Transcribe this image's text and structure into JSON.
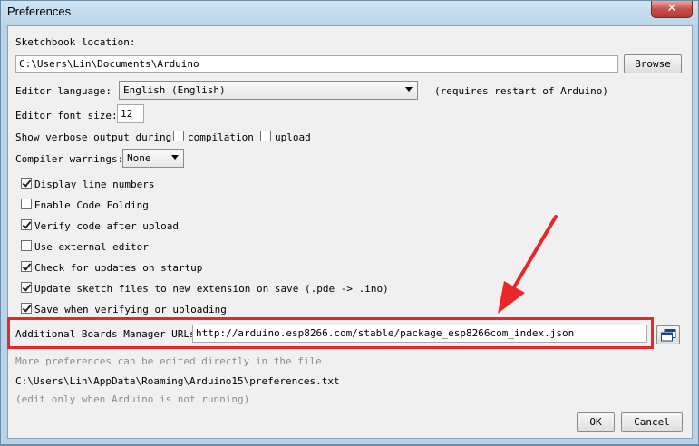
{
  "window": {
    "title": "Preferences",
    "close_glyph": "✕"
  },
  "sketchbook": {
    "label": "Sketchbook location:",
    "path": "C:\\Users\\Lin\\Documents\\Arduino",
    "browse_label": "Browse"
  },
  "language": {
    "label": "Editor language:",
    "value": "English (English)",
    "note": "(requires restart of Arduino)"
  },
  "font_size": {
    "label": "Editor font size:",
    "value": "12"
  },
  "verbose": {
    "label": "Show verbose output during:",
    "compilation_label": "compilation",
    "compilation_checked": false,
    "upload_label": "upload",
    "upload_checked": false
  },
  "warnings": {
    "label": "Compiler warnings:",
    "value": "None"
  },
  "options": [
    {
      "label": "Display line numbers",
      "checked": true
    },
    {
      "label": "Enable Code Folding",
      "checked": false
    },
    {
      "label": "Verify code after upload",
      "checked": true
    },
    {
      "label": "Use external editor",
      "checked": false
    },
    {
      "label": "Check for updates on startup",
      "checked": true
    },
    {
      "label": "Update sketch files to new extension on save (.pde -> .ino)",
      "checked": true
    },
    {
      "label": "Save when verifying or uploading",
      "checked": true
    }
  ],
  "boards_urls": {
    "label": "Additional Boards Manager URLs:",
    "value": "http://arduino.esp8266.com/stable/package_esp8266com_index.json",
    "edit_icon": "window-list-icon"
  },
  "footer": {
    "more_prefs": "More preferences can be edited directly in the file",
    "prefs_path": "C:\\Users\\Lin\\AppData\\Roaming\\Arduino15\\preferences.txt",
    "edit_note": "(edit only when Arduino is not running)"
  },
  "buttons": {
    "ok": "OK",
    "cancel": "Cancel"
  },
  "colors": {
    "highlight": "#e8262b",
    "arrow": "#e8262b"
  }
}
